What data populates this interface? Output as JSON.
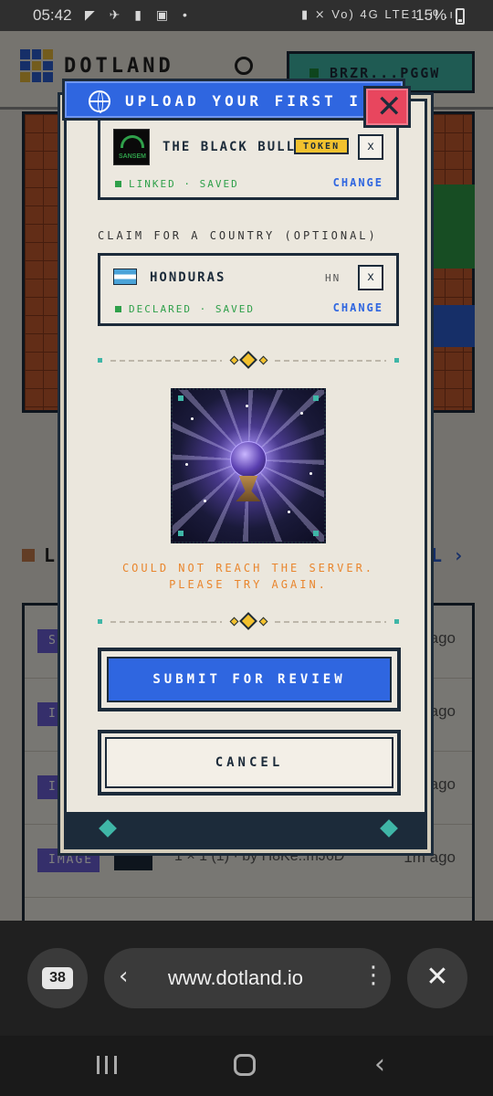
{
  "status_bar": {
    "time": "05:42",
    "left_icons": "◤ ✈ ▮ ▣ •",
    "right_icons": "▮ ⨯ Vo) 4G LTE1 .ıl .ıl",
    "battery": "15%"
  },
  "site": {
    "name": "DOTLAND",
    "wallet": "BRZR...PGGW",
    "list_heading": "LI",
    "list_more": "LL ›",
    "rows": [
      {
        "tag": "SE",
        "sub": "",
        "time": "ago"
      },
      {
        "tag": "IMA",
        "sub": "",
        "time": "ago"
      },
      {
        "tag": "IMA",
        "sub": "",
        "time": "ago"
      },
      {
        "tag": "IMAGE",
        "sub": "1 × 1 (1) · by H8Ke..mJ6D",
        "time": "1m ago"
      }
    ]
  },
  "modal": {
    "title": "UPLOAD YOUR FIRST I...",
    "close_label": "✕",
    "token_card": {
      "thumb_label": "SANSEM",
      "name": "THE BLACK BULL",
      "badge": "TOKEN",
      "remove": "x",
      "status": "LINKED · SAVED",
      "change": "CHANGE"
    },
    "country_section_label": "CLAIM FOR A COUNTRY (OPTIONAL)",
    "country_card": {
      "name": "HONDURAS",
      "code": "HN",
      "remove": "x",
      "status": "DECLARED · SAVED",
      "change": "CHANGE"
    },
    "error": "COULD NOT REACH THE SERVER. PLEASE TRY AGAIN.",
    "submit_label": "SUBMIT FOR REVIEW",
    "cancel_label": "CANCEL"
  },
  "browser": {
    "tab_count": "38",
    "url": "www.dotland.io",
    "back_icon": "‹",
    "more_icon": "⋮",
    "close_icon": "✕"
  },
  "colors": {
    "accent_blue": "#2f66e0",
    "teal": "#3fb6a7",
    "error_orange": "#e9862e",
    "success_green": "#2fa04a",
    "close_red": "#e8465e",
    "badge_yellow": "#f2c12e",
    "dark_navy": "#1c2b3a"
  }
}
